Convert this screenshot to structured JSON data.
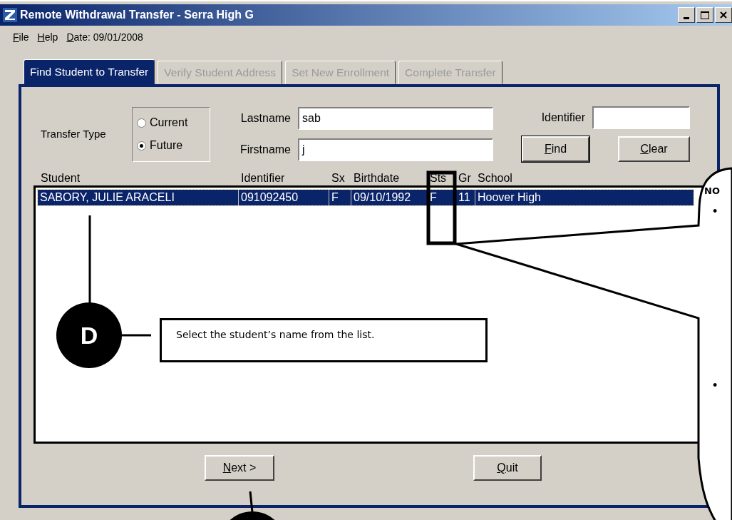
{
  "window": {
    "title": "Remote Withdrawal Transfer - Serra High G"
  },
  "menu": [
    {
      "label": "File",
      "accelerator": true
    },
    {
      "label": "Help",
      "accelerator": true
    },
    {
      "label": "Date: 09/01/2008",
      "accelerator": true
    }
  ],
  "tabs": [
    {
      "label": "Find Student to Transfer",
      "selected": true,
      "disabled": false
    },
    {
      "label": "Verify Student Address",
      "selected": false,
      "disabled": true
    },
    {
      "label": "Set New Enrollment",
      "selected": false,
      "disabled": true
    },
    {
      "label": "Complete Transfer",
      "selected": false,
      "disabled": true
    }
  ],
  "transfer_type": {
    "label": "Transfer Type",
    "options": [
      {
        "label": "Current",
        "selected": false
      },
      {
        "label": "Future",
        "selected": true
      }
    ]
  },
  "name_fields": [
    {
      "label": "Lastname",
      "value": "sab"
    },
    {
      "label": "Firstname",
      "value": "j"
    }
  ],
  "identifier_field": {
    "label": "Identifier"
  },
  "search_buttons": [
    {
      "label": "Find",
      "accelerator": true,
      "default": true
    },
    {
      "label": "Clear",
      "accelerator": true,
      "default": false
    }
  ],
  "results": {
    "columns": [
      "Student",
      "Identifier",
      "Sx",
      "Birthdate",
      "Sts",
      "Gr",
      "School"
    ],
    "rows": [
      {
        "cells": [
          "SABORY, JULIE ARACELI",
          "091092450",
          "F",
          "09/10/1992",
          "F",
          "11",
          "Hoover High"
        ],
        "selected": true
      }
    ]
  },
  "footer_buttons": [
    {
      "label": "Next >",
      "accelerator": true
    },
    {
      "label": "Quit",
      "accelerator": true
    }
  ],
  "callouts": {
    "marker": "D",
    "text": "Select the student’s name from the list.",
    "note_heading": "NO",
    "note_bullets": [
      "•",
      "•"
    ]
  }
}
